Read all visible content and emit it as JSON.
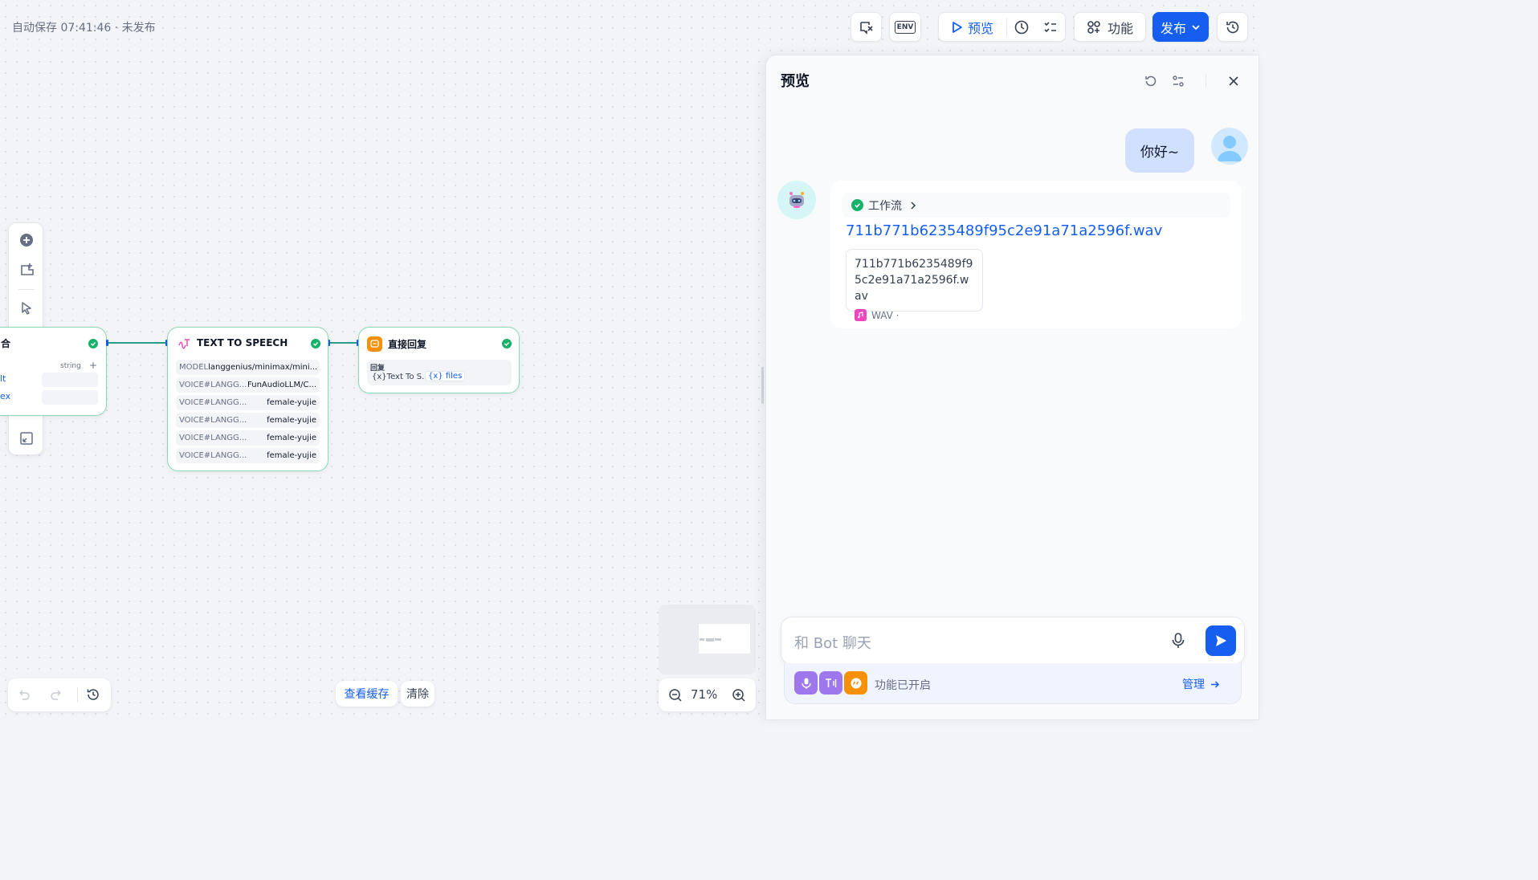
{
  "header": {
    "autosave": "自动保存 07:41:46 · 未发布",
    "env_label": "ENV",
    "preview_label": "预览",
    "features_label": "功能",
    "publish_label": "发布"
  },
  "nodes": {
    "start_partial": {
      "title_fragment": "合",
      "var_type": "string",
      "add": "+",
      "left_fragments": [
        "lt",
        "ex"
      ]
    },
    "tts": {
      "title": "TEXT TO SPEECH",
      "rows": [
        {
          "key": "MODEL",
          "value": "langgenius/minimax/mini..."
        },
        {
          "key": "VOICE#LANGG...",
          "value": "FunAudioLLM/C..."
        },
        {
          "key": "VOICE#LANGG...",
          "value": "female-yujie"
        },
        {
          "key": "VOICE#LANGG...",
          "value": "female-yujie"
        },
        {
          "key": "VOICE#LANGG...",
          "value": "female-yujie"
        },
        {
          "key": "VOICE#LANGG...",
          "value": "female-yujie"
        }
      ]
    },
    "answer": {
      "title": "直接回复",
      "section_label": "回复",
      "var_prefix": "{x}",
      "var_node": "Text To S...",
      "var_icon": "{x}",
      "var_name": "files"
    }
  },
  "bottom": {
    "view_cache": "查看缓存",
    "clear": "清除",
    "zoom": "71%"
  },
  "preview_panel": {
    "title": "预览",
    "user_message": "你好~",
    "workflow_label": "工作流",
    "file_link": "711b771b6235489f95c2e91a71a2596f.wav",
    "file_name": "711b771b6235489f95c2e91a71a2596f.wav",
    "file_type": "WAV ·",
    "input_placeholder": "和 Bot 聊天",
    "features_enabled": "功能已开启",
    "manage": "管理"
  },
  "colors": {
    "accent": "#155eef",
    "success": "#17b26a",
    "node_border": "#8ad7b4"
  }
}
